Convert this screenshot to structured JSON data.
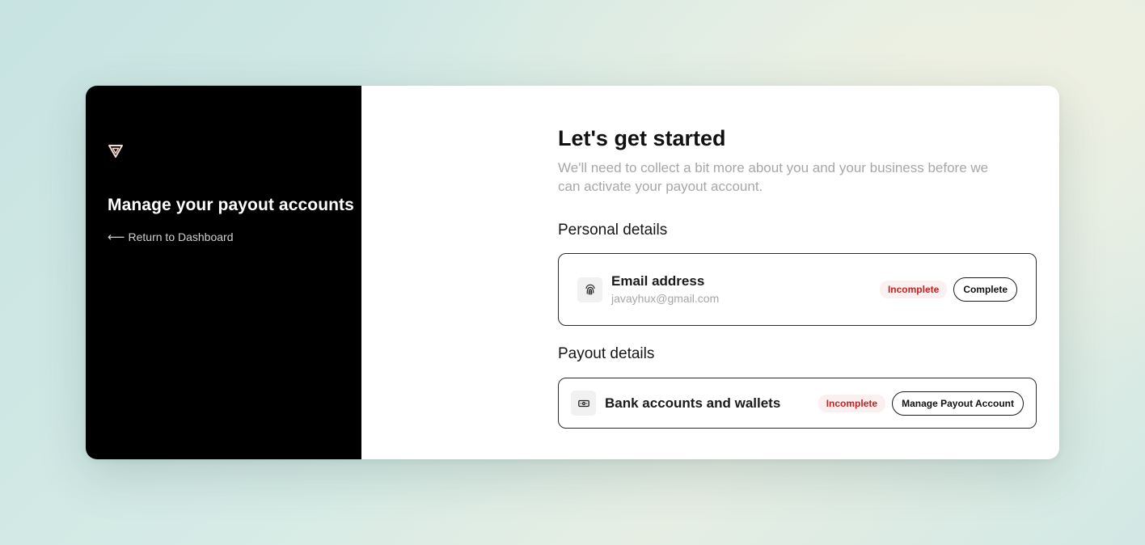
{
  "sidebar": {
    "logo_icon": "triangle-logo-icon",
    "title": "Manage your payout accounts",
    "back_arrow": "⟵",
    "back_link": "Return to Dashboard"
  },
  "main": {
    "title": "Let's get started",
    "subtitle": "We'll need to collect a bit more about you and your business before we can activate your payout account.",
    "personal_section": {
      "heading": "Personal details",
      "item": {
        "icon": "fingerprint-icon",
        "title": "Email address",
        "value": "javayhux@gmail.com",
        "status": "Incomplete",
        "action": "Complete"
      }
    },
    "payout_section": {
      "heading": "Payout details",
      "item": {
        "icon": "banknote-icon",
        "title": "Bank accounts and wallets",
        "status": "Incomplete",
        "action": "Manage Payout Account"
      }
    }
  },
  "colors": {
    "sidebar_bg": "#000000",
    "badge_text": "#c72222",
    "badge_bg": "#fbf0f0",
    "logo": "#f3d9cf"
  }
}
